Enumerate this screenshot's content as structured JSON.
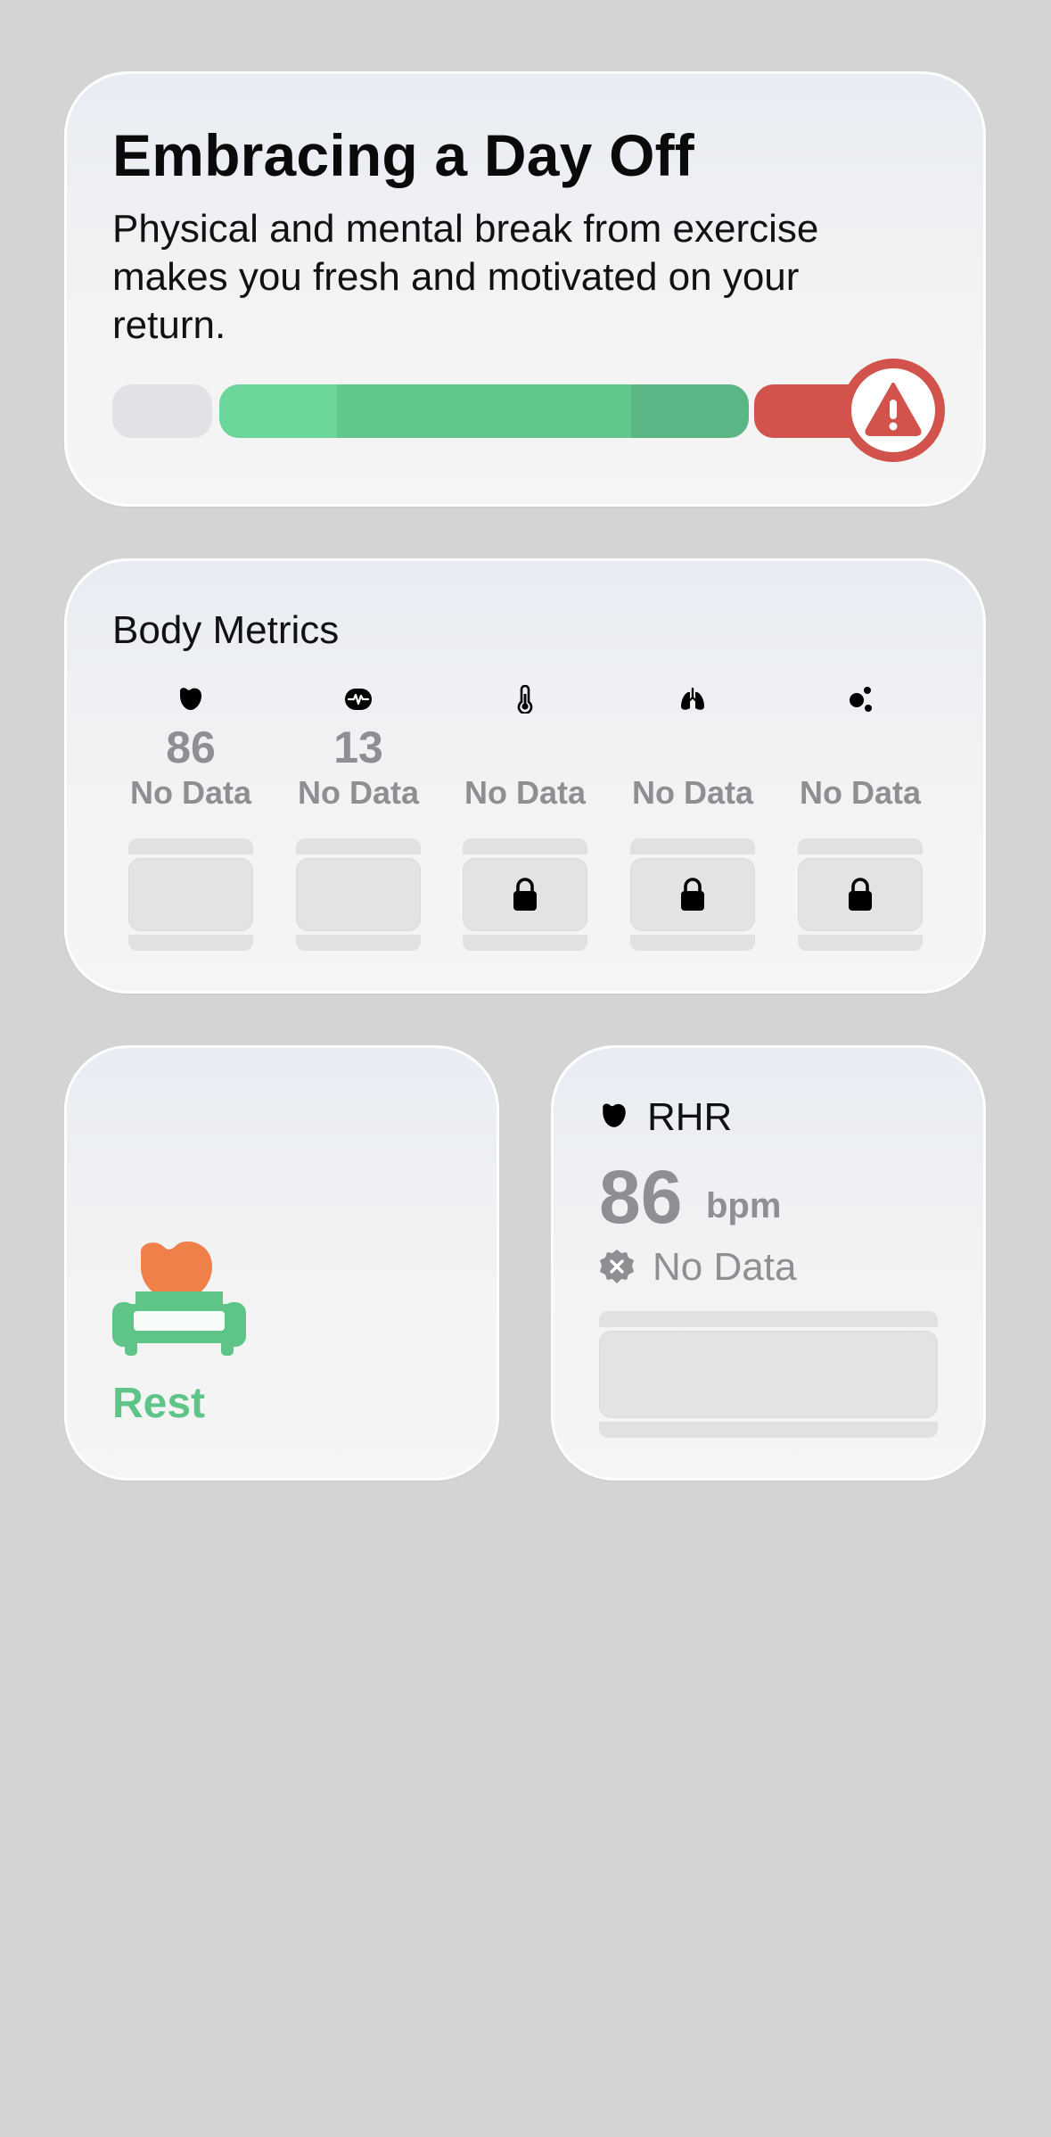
{
  "day_off_card": {
    "title": "Embracing a Day Off",
    "description": "Physical and mental break from exercise makes you fresh and motivated on your return.",
    "gauge_segments": [
      "gray",
      "green",
      "red"
    ],
    "active_segment": "red",
    "indicator_icon": "warning-icon",
    "colors": {
      "green": "#62c78d",
      "red": "#d1534c",
      "gray": "#e0e2e5"
    }
  },
  "body_metrics": {
    "title": "Body Metrics",
    "items": [
      {
        "icon": "heart-icon",
        "value": "86",
        "status": "No Data",
        "locked": false
      },
      {
        "icon": "heartbeat-monitor-icon",
        "value": "13",
        "status": "No Data",
        "locked": false
      },
      {
        "icon": "thermometer-icon",
        "value": "",
        "status": "No Data",
        "locked": true
      },
      {
        "icon": "lungs-icon",
        "value": "",
        "status": "No Data",
        "locked": true
      },
      {
        "icon": "molecule-icon",
        "value": "",
        "status": "No Data",
        "locked": true
      }
    ]
  },
  "rest_card": {
    "icon": "sofa-heart-icon",
    "label": "Rest",
    "accent_color": "#5ec488"
  },
  "rhr_card": {
    "icon": "heart-icon",
    "label": "RHR",
    "value": "86",
    "unit": "bpm",
    "status_icon": "cross-badge-icon",
    "status": "No Data"
  }
}
